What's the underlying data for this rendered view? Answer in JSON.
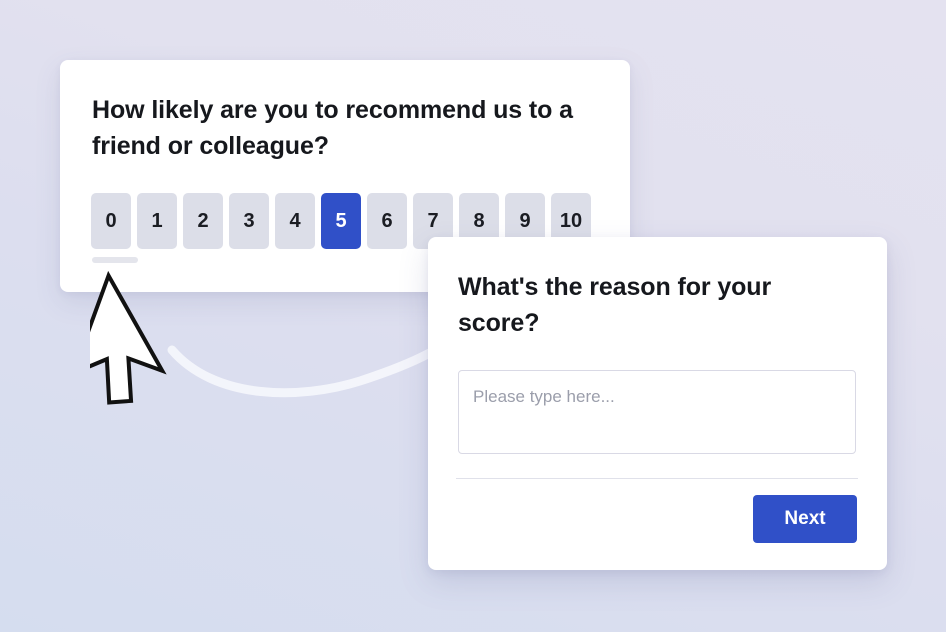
{
  "background": {
    "gradient_from": "#e4e2f0",
    "gradient_to": "#d5ddef"
  },
  "theme": {
    "accent": "#3050c8",
    "card_background": "#ffffff",
    "scale_button_background": "#dcdee8",
    "text_primary": "#16181d",
    "placeholder_color": "#9b9eab",
    "divider_color": "#e0e1ea",
    "input_border": "#d9d9e5"
  },
  "nps_card": {
    "question": "How likely are you to recommend us to a friend or colleague?",
    "scale": {
      "options": [
        "0",
        "1",
        "2",
        "3",
        "4",
        "5",
        "6",
        "7",
        "8",
        "9",
        "10"
      ],
      "selected_value": "5",
      "min": 0,
      "max": 10
    },
    "progress": {
      "label": "progress-bar"
    }
  },
  "reason_card": {
    "question": "What's the reason for your score?",
    "input": {
      "placeholder": "Please type here...",
      "value": ""
    },
    "next_label": "Next"
  },
  "cursor": {
    "icon": "arrow-pointer-icon"
  },
  "connector": {
    "icon": "curved-connector-line"
  }
}
